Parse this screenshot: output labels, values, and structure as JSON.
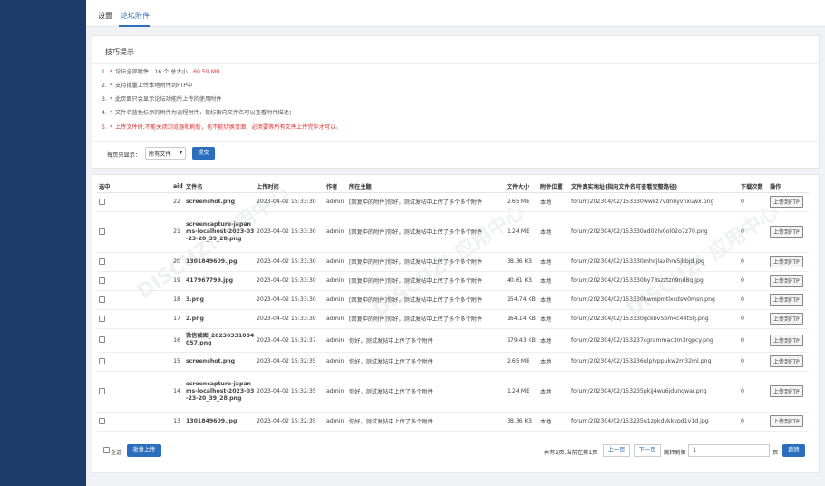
{
  "tabs": [
    "设置",
    "论坛附件"
  ],
  "tips": {
    "title": "技巧提示",
    "total_prefix": "论坛全部附件：16 个 总大小：",
    "total_size": "69.59 MB",
    "items": [
      "支持批量上传本地附件到FTP中",
      "此页面只会显示论坛功能所上传的使用附件",
      "文件名蓝色标示的附件为远程附件，鼠标指向文件名可以查看附件描述；",
      "上传文件时,不能关闭浏览器和刷新，也不能切换页面，必须要等所有文件上传完毕才可以。"
    ]
  },
  "filter": {
    "label": "每页只显示：",
    "selected": "所有文件",
    "submit": "提交"
  },
  "table": {
    "headers": [
      "选中",
      "aid",
      "文件名",
      "上传时间",
      "作者",
      "所在主题",
      "文件大小",
      "附件位置",
      "文件真实地址(指向文件名可查看完整路径)",
      "下载次数",
      "操作"
    ],
    "rows": [
      {
        "aid": "22",
        "name": "screenshot.png",
        "time": "2023-04-02 15:33:30",
        "author": "admin",
        "thread": "[回复中的附件]你好，测试发帖中上传了多个多个附件",
        "size": "2.65 MB",
        "loc": "本地",
        "path": "forum/202304/02/153330wwkz7vdnhyvnxuwx.png",
        "dl": "0",
        "op": "上传到FTP"
      },
      {
        "aid": "21",
        "name": "screencapture-japanms-localhost-2023-03-23-20_39_28.png",
        "time": "2023-04-02 15:33:30",
        "author": "admin",
        "thread": "[回复中的附件]你好，测试发帖中上传了多个多个附件",
        "size": "1.24 MB",
        "loc": "本地",
        "path": "forum/202304/02/153330ad02lv0ol02o7z70.png",
        "dl": "0",
        "op": "上传到FTP"
      },
      {
        "aid": "20",
        "name": "1301849609.jpg",
        "time": "2023-04-02 15:33:30",
        "author": "admin",
        "thread": "[回复中的附件]你好，测试发帖中上传了多个多个附件",
        "size": "38.36 KB",
        "loc": "本地",
        "path": "forum/202304/02/153330mhdjlaxlhm5jbbjd.jpg",
        "dl": "0",
        "op": "上传到FTP"
      },
      {
        "aid": "19",
        "name": "417967799.jpg",
        "time": "2023-04-02 15:33:30",
        "author": "admin",
        "thread": "[回复中的附件]你好，测试发帖中上传了多个多个附件",
        "size": "40.61 KB",
        "loc": "本地",
        "path": "forum/202304/02/153330by78szztzn9nd8q.jpg",
        "dl": "0",
        "op": "上传到FTP"
      },
      {
        "aid": "18",
        "name": "3.png",
        "time": "2023-04-02 15:33:30",
        "author": "admin",
        "thread": "[回复中的附件]你好，测试发帖中上传了多个多个附件",
        "size": "154.74 KB",
        "loc": "本地",
        "path": "forum/202304/02/153330hwmpmtlxcdsw0msn.png",
        "dl": "0",
        "op": "上传到FTP"
      },
      {
        "aid": "17",
        "name": "2.png",
        "time": "2023-04-02 15:33:30",
        "author": "admin",
        "thread": "[回复中的附件]你好，测试发帖中上传了多个多个附件",
        "size": "164.14 KB",
        "loc": "本地",
        "path": "forum/202304/02/153330gckbv5bm4c44t5tj.png",
        "dl": "0",
        "op": "上传到FTP"
      },
      {
        "aid": "16",
        "name": "微信截图_20230331084057.png",
        "time": "2023-04-02 15:32:37",
        "author": "admin",
        "thread": "你好，测试发帖中上传了多个附件",
        "size": "179.43 KB",
        "loc": "本地",
        "path": "forum/202304/02/153237cgrammac3m3rgpcy.png",
        "dl": "0",
        "op": "上传到FTP"
      },
      {
        "aid": "15",
        "name": "screenshot.png",
        "time": "2023-04-02 15:32:35",
        "author": "admin",
        "thread": "你好，测试发帖中上传了多个附件",
        "size": "2.65 MB",
        "loc": "本地",
        "path": "forum/202304/02/153236ulplyppukw2m32ml.png",
        "dl": "0",
        "op": "上传到FTP"
      },
      {
        "aid": "14",
        "name": "screencapture-japanms-localhost-2023-03-23-20_39_28.png",
        "time": "2023-04-02 15:32:35",
        "author": "admin",
        "thread": "你好，测试发帖中上传了多个附件",
        "size": "1.24 MB",
        "loc": "本地",
        "path": "forum/202304/02/153235pkjj4wu6jdungwar.png",
        "dl": "0",
        "op": "上传到FTP"
      },
      {
        "aid": "13",
        "name": "1301849609.jpg",
        "time": "2023-04-02 15:32:35",
        "author": "admin",
        "thread": "你好，测试发帖中上传了多个附件",
        "size": "38.36 KB",
        "loc": "本地",
        "path": "forum/202304/02/153235u1zpkdykkvpd1v1d.jpg",
        "dl": "0",
        "op": "上传到FTP"
      }
    ]
  },
  "footer": {
    "select_all": "全选",
    "batch_upload": "批量上传",
    "page_info": "共有2页,当前在第1页",
    "prev": "上一页",
    "next": "下一页",
    "jump_label": "跳转到第",
    "page_value": "1",
    "page_unit": "页",
    "jump_btn": "跳转"
  },
  "colors": {
    "sidebar": "#1d3c6b",
    "accent": "#2a6ebd",
    "warn": "#d33333"
  }
}
